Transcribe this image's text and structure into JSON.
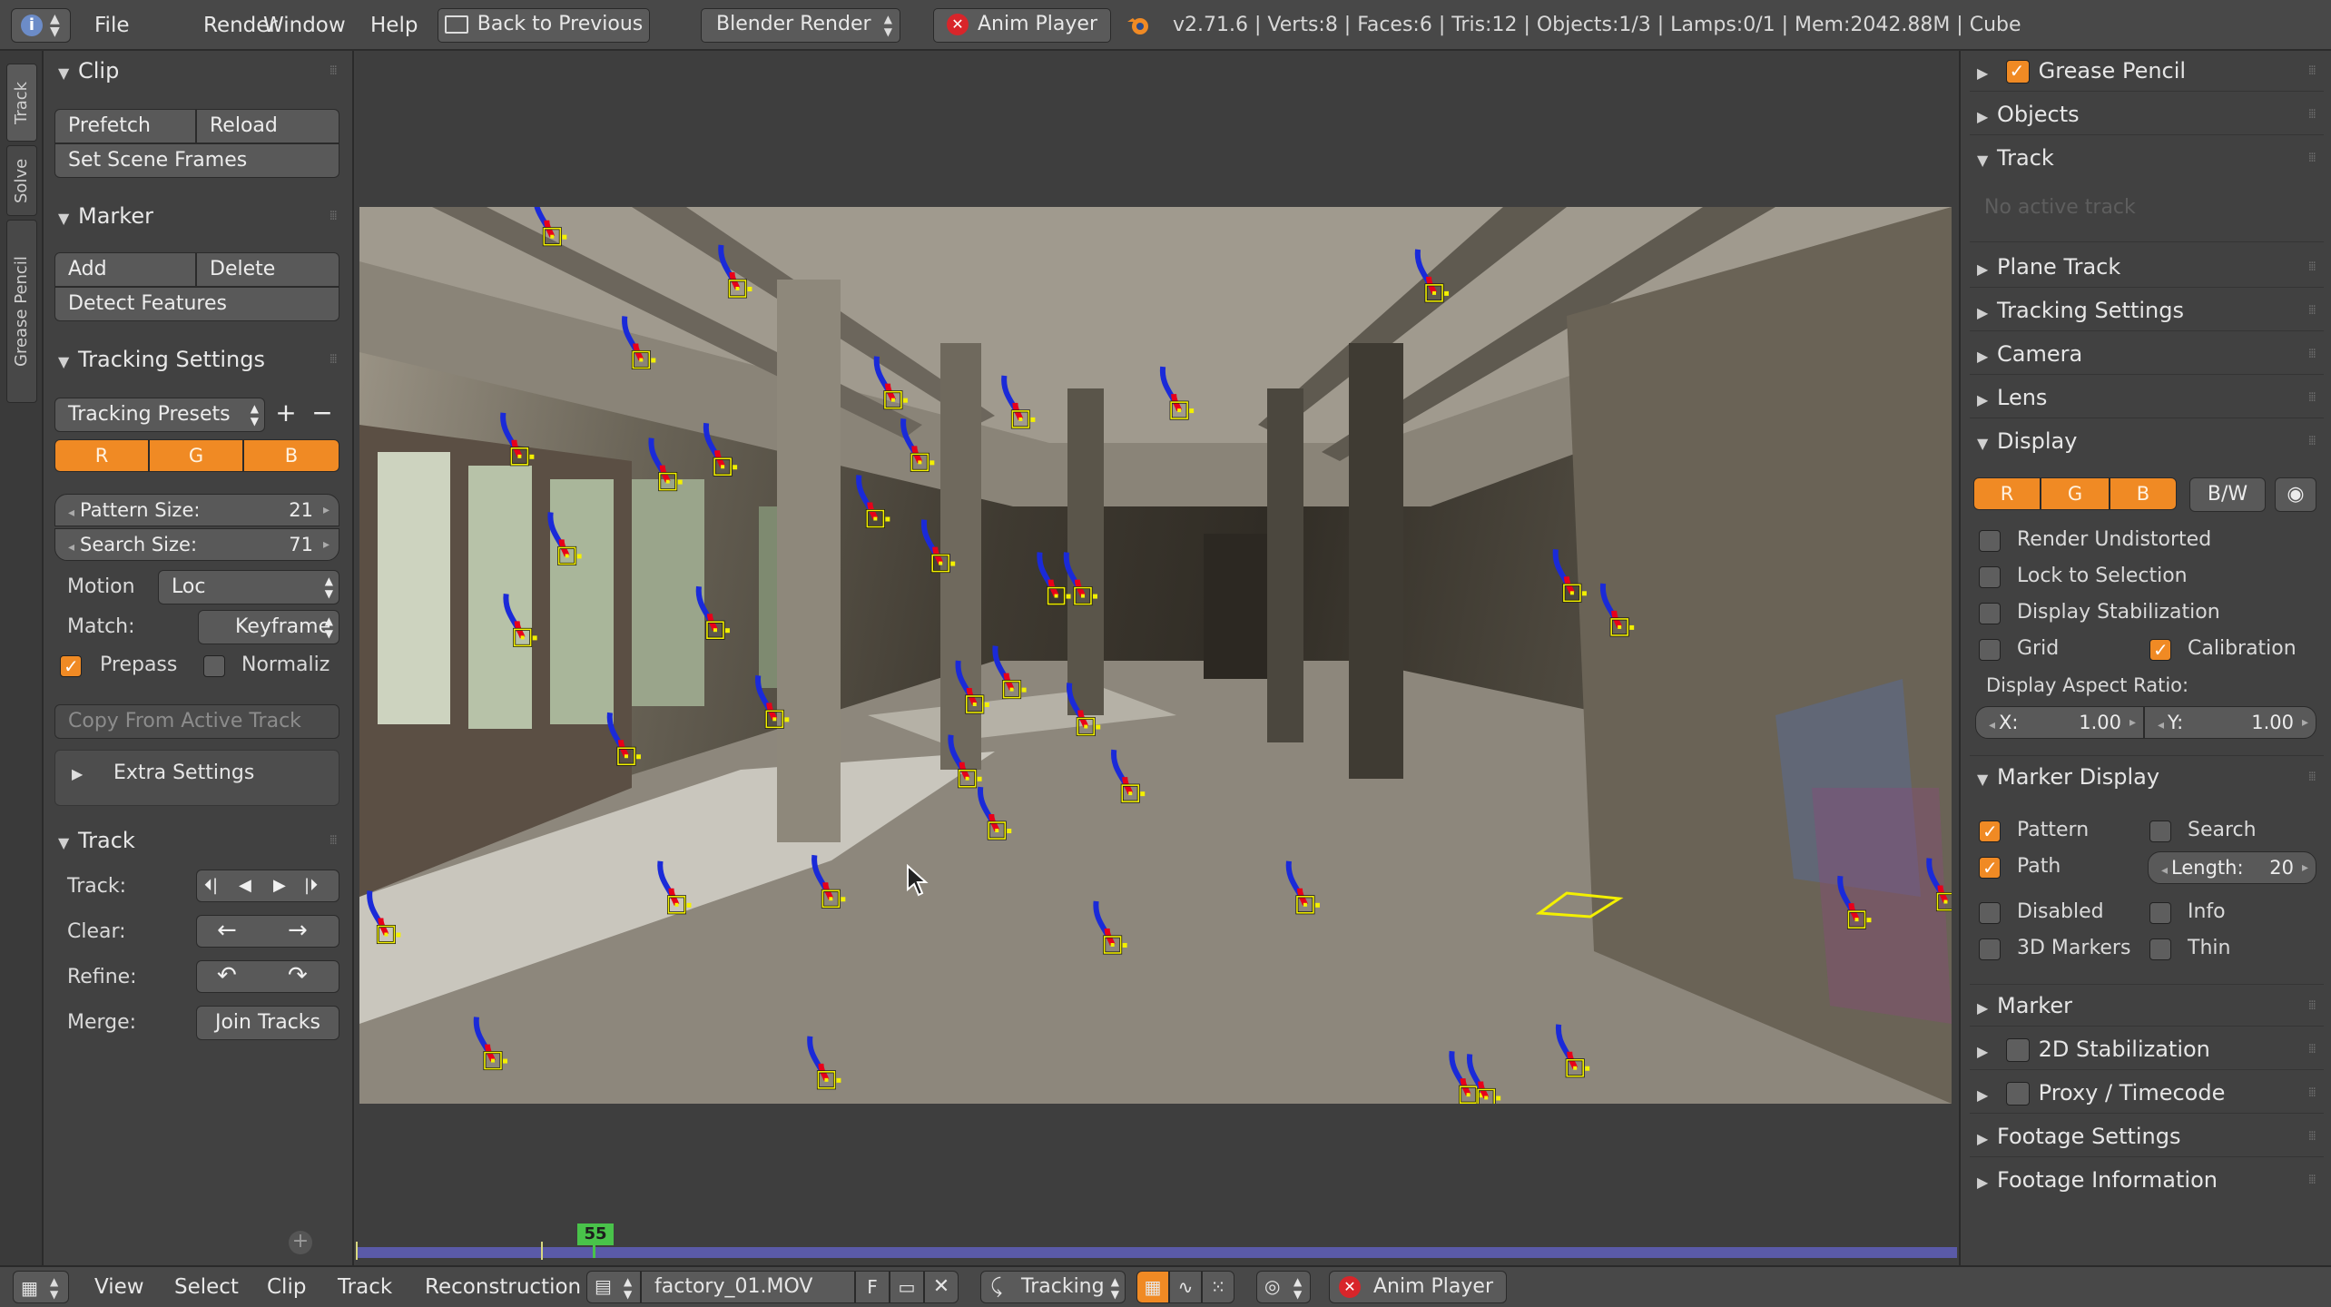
{
  "header": {
    "menus": [
      "File",
      "Render",
      "Window",
      "Help"
    ],
    "back_button": "Back to Previous",
    "render_engine": "Blender Render",
    "anim_player": "Anim Player",
    "stats": "v2.71.6 | Verts:8 | Faces:6 | Tris:12 | Objects:1/3 | Lamps:0/1 | Mem:2042.88M | Cube"
  },
  "left_tabs": [
    "Track",
    "Solve",
    "Grease Pencil"
  ],
  "left": {
    "clip": {
      "title": "Clip",
      "prefetch": "Prefetch",
      "reload": "Reload",
      "set_scene_frames": "Set Scene Frames"
    },
    "marker": {
      "title": "Marker",
      "add": "Add",
      "delete": "Delete",
      "detect": "Detect Features"
    },
    "tracking_settings": {
      "title": "Tracking Settings",
      "presets": "Tracking Presets",
      "r": "R",
      "g": "G",
      "b": "B",
      "pattern_size_label": "Pattern Size:",
      "pattern_size": "21",
      "search_size_label": "Search Size:",
      "search_size": "71",
      "motion_label": "Motion",
      "motion": "Loc",
      "match_label": "Match:",
      "match": "Keyframe",
      "prepass": "Prepass",
      "normalize": "Normaliz",
      "copy_from_active": "Copy From Active Track",
      "extra_settings": "Extra Settings"
    },
    "track": {
      "title": "Track",
      "track_label": "Track:",
      "clear_label": "Clear:",
      "refine_label": "Refine:",
      "merge_label": "Merge:",
      "join_tracks": "Join Tracks"
    }
  },
  "right": {
    "grease_pencil": "Grease Pencil",
    "objects": "Objects",
    "track": "Track",
    "no_active_track": "No active track",
    "plane_track": "Plane Track",
    "tracking_settings": "Tracking Settings",
    "camera": "Camera",
    "lens": "Lens",
    "display": {
      "title": "Display",
      "r": "R",
      "g": "G",
      "b": "B",
      "bw": "B/W",
      "render_undistorted": "Render Undistorted",
      "lock_to_selection": "Lock to Selection",
      "display_stabilization": "Display Stabilization",
      "grid": "Grid",
      "calibration": "Calibration",
      "aspect_label": "Display Aspect Ratio:",
      "x_label": "X:",
      "x": "1.00",
      "y_label": "Y:",
      "y": "1.00"
    },
    "marker_display": {
      "title": "Marker Display",
      "pattern": "Pattern",
      "search": "Search",
      "path": "Path",
      "length_label": "Length:",
      "length": "20",
      "disabled": "Disabled",
      "info": "Info",
      "markers_3d": "3D Markers",
      "thin": "Thin"
    },
    "marker": "Marker",
    "stabilization_2d": "2D Stabilization",
    "proxy": "Proxy / Timecode",
    "footage_settings": "Footage Settings",
    "footage_information": "Footage Information"
  },
  "timeline": {
    "current_frame": "55",
    "frame_fraction": 0.14
  },
  "footer": {
    "menus": [
      "View",
      "Select",
      "Clip",
      "Track",
      "Reconstruction"
    ],
    "clip_name": "factory_01.MOV",
    "fake_user": "F",
    "mode": "Tracking",
    "anim_player": "Anim Player"
  },
  "colors": {
    "accent": "#f08a24",
    "marker": "#f3f000",
    "path_red": "#e8001a",
    "path_blue": "#1a2ad8"
  },
  "tracking_marker_count": 42
}
